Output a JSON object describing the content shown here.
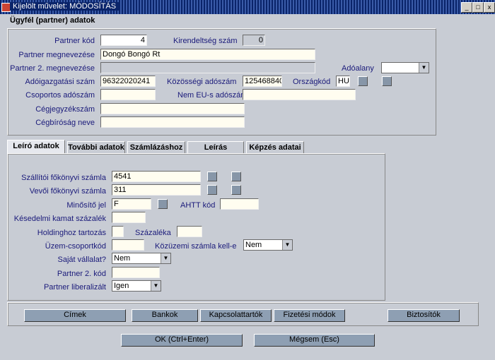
{
  "window": {
    "title": "Kijelölt művelet: MÓDOSÍTÁS",
    "minimize": "_",
    "maximize": "□",
    "close": "x"
  },
  "heading": "Ügyfél (partner) adatok",
  "top": {
    "partner_kod_label": "Partner kód",
    "partner_kod_value": "4",
    "kirendeltseg_label": "Kirendeltség szám",
    "kirendeltseg_value": "0",
    "megnevezes_label": "Partner megnevezése",
    "megnevezes_value": "Dongó  Bongó Rt",
    "megnevezes2_label": "Partner 2. megnevezése",
    "adoalany_label": "Adóalany",
    "adoazonosito_label": "Adóigazgatási szám",
    "adoazonosito_value": "96322020241",
    "kozossegi_label": "Közösségi adószám",
    "kozossegi_value": "125468840",
    "orszagkod_label": "Országkód",
    "orszagkod_value": "HU",
    "csoportos_label": "Csoportos adószám",
    "nem_eu_label": "Nem EU-s adószám",
    "cegjegyzek_label": "Cégjegyzékszám",
    "cegbirosag_label": "Cégbíróság neve"
  },
  "tabs": [
    "Leíró adatok",
    "További adatok",
    "Számlázáshoz",
    "Leírás",
    "Képzés adatai"
  ],
  "leiro": {
    "szallitoi_label": "Szállítói főkönyvi számla",
    "szallitoi_value": "4541",
    "vevoi_label": "Vevői főkönyvi számla",
    "vevoi_value": "311",
    "minosito_label": "Minősítő jel",
    "minosito_value": "F",
    "ahtt_label": "AHTT kód",
    "kesedelmi_label": "Késedelmi kamat százalék",
    "holding_label": "Holdinghoz tartozás",
    "szazaleka_label": "Százaléka",
    "uzem_label": "Üzem-csoportkód",
    "kozuzemi_label": "Közüzemi számla kell-e",
    "kozuzemi_value": "Nem",
    "sajat_label": "Saját vállalat?",
    "sajat_value": "Nem",
    "partner2_label": "Partner 2. kód",
    "liberalizalt_label": "Partner liberalizált",
    "liberalizalt_value": "Igen"
  },
  "buttons": {
    "cimek": "Címek",
    "bankok": "Bankok",
    "kapcsolattartok": "Kapcsolattartók",
    "fizetesi": "Fizetési módok",
    "biztositok": "Biztosítók",
    "ok": "OK (Ctrl+Enter)",
    "megsem": "Mégsem (Esc)"
  }
}
